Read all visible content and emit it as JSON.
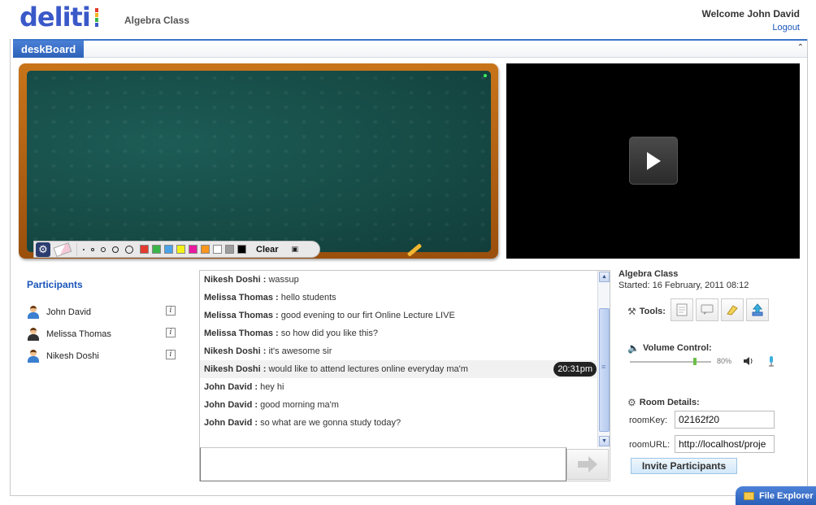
{
  "app": {
    "logo": "deliti",
    "class_title": "Algebra Class",
    "welcome": "Welcome John David",
    "logout": "Logout",
    "logo_colors": [
      "#e33b2e",
      "#f3b51f",
      "#3ab54a",
      "#3a59c9"
    ]
  },
  "deskboard": {
    "tab_label": "deskBoard",
    "toolbar": {
      "clear_label": "Clear",
      "brush_sizes": [
        "1",
        "2",
        "3",
        "4",
        "5"
      ],
      "colors": [
        "#e33b2e",
        "#3ab54a",
        "#4aa3e8",
        "#f2f21a",
        "#e81ba0",
        "#f7951e",
        "#ffffff",
        "#9c9c9c",
        "#000000"
      ]
    }
  },
  "participants": {
    "title": "Participants",
    "items": [
      {
        "name": "John David"
      },
      {
        "name": "Melissa Thomas"
      },
      {
        "name": "Nikesh Doshi"
      }
    ],
    "info_glyph": "i"
  },
  "chat": {
    "messages": [
      {
        "sender": "Nikesh Doshi :",
        "text": " wassup"
      },
      {
        "sender": "Melissa Thomas :",
        "text": " hello students"
      },
      {
        "sender": "Melissa Thomas :",
        "text": " good evening to our firt Online Lecture LIVE"
      },
      {
        "sender": "Melissa Thomas :",
        "text": " so how did you like this?"
      },
      {
        "sender": "Nikesh Doshi :",
        "text": " it's awesome sir"
      },
      {
        "sender": "Nikesh Doshi :",
        "text": " would like to attend lectures online everyday ma'm",
        "time": "20:31pm"
      },
      {
        "sender": "John David :",
        "text": " hey hi"
      },
      {
        "sender": "John David :",
        "text": " good morning ma'm"
      },
      {
        "sender": "John David :",
        "text": " so what are we gonna study today?"
      }
    ]
  },
  "room": {
    "title": "Algebra Class",
    "started": "Started: 16 February, 2011 08:12",
    "tools_label": "Tools:",
    "volume_label": "Volume Control:",
    "volume_level": 0.8,
    "volume_pct": "80%",
    "details_label": "Room Details:",
    "room_key_label": "roomKey:",
    "room_key_value": "02162f20",
    "room_url_label": "roomURL:",
    "room_url_value": "http://localhost/proje",
    "invite_label": "Invite Participants"
  },
  "file_explorer": {
    "label": "File Explorer"
  }
}
